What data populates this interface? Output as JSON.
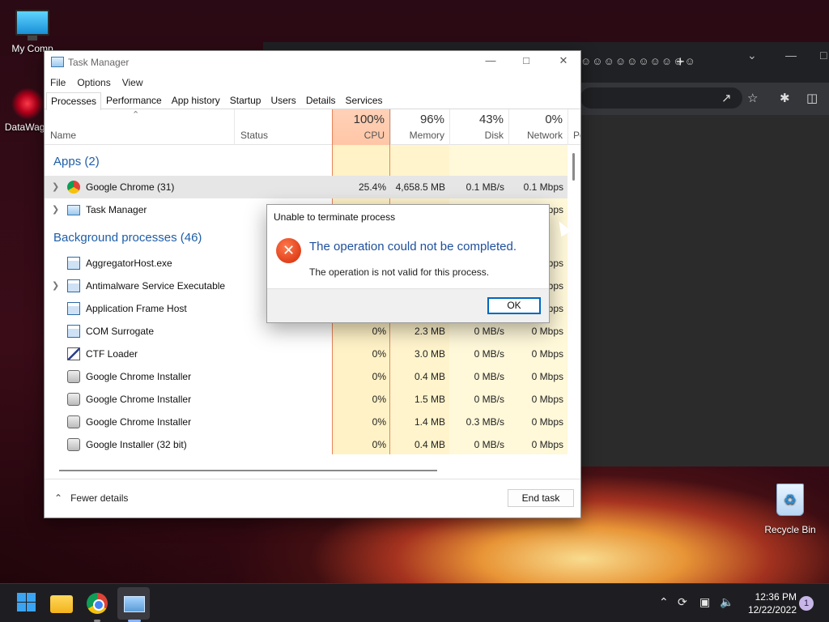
{
  "desktop": {
    "icons": [
      {
        "label": "My Comp"
      },
      {
        "label": "DataWage"
      }
    ],
    "recycle_bin_label": "Recycle Bin"
  },
  "browser_bg": {
    "tab_text": "☺☺☺☺☺☺☺☺☺☺",
    "new_tab": "+"
  },
  "task_manager": {
    "title": "Task Manager",
    "menu": [
      "File",
      "Options",
      "View"
    ],
    "tabs": [
      "Processes",
      "Performance",
      "App history",
      "Startup",
      "Users",
      "Details",
      "Services"
    ],
    "active_tab": "Processes",
    "columns": {
      "name": "Name",
      "status": "Status",
      "cpu": {
        "pct": "100%",
        "label": "CPU"
      },
      "memory": {
        "pct": "96%",
        "label": "Memory"
      },
      "disk": {
        "pct": "43%",
        "label": "Disk"
      },
      "network": {
        "pct": "0%",
        "label": "Network"
      },
      "power_partial": "Po"
    },
    "groups": {
      "apps": "Apps (2)",
      "background": "Background processes (46)"
    },
    "rows": [
      {
        "name": "Google Chrome (31)",
        "cpu": "25.4%",
        "memory": "4,658.5 MB",
        "disk": "0.1 MB/s",
        "network": "0.1 Mbps"
      },
      {
        "name": "Task Manager",
        "cpu": "",
        "memory": "",
        "disk": "",
        "network": "Mbps"
      },
      {
        "name": "AggregatorHost.exe",
        "cpu": "",
        "memory": "",
        "disk": "",
        "network": "Mbps"
      },
      {
        "name": "Antimalware Service Executable",
        "cpu": "",
        "memory": "",
        "disk": "",
        "network": "Mbps"
      },
      {
        "name": "Application Frame Host",
        "cpu": "",
        "memory": "",
        "disk": "",
        "network": "Mbps"
      },
      {
        "name": "COM Surrogate",
        "cpu": "0%",
        "memory": "2.3 MB",
        "disk": "0 MB/s",
        "network": "0 Mbps"
      },
      {
        "name": "CTF Loader",
        "cpu": "0%",
        "memory": "3.0 MB",
        "disk": "0 MB/s",
        "network": "0 Mbps"
      },
      {
        "name": "Google Chrome Installer",
        "cpu": "0%",
        "memory": "0.4 MB",
        "disk": "0 MB/s",
        "network": "0 Mbps"
      },
      {
        "name": "Google Chrome Installer",
        "cpu": "0%",
        "memory": "1.5 MB",
        "disk": "0 MB/s",
        "network": "0 Mbps"
      },
      {
        "name": "Google Chrome Installer",
        "cpu": "0%",
        "memory": "1.4 MB",
        "disk": "0.3 MB/s",
        "network": "0 Mbps"
      },
      {
        "name": "Google Installer (32 bit)",
        "cpu": "0%",
        "memory": "0.4 MB",
        "disk": "0 MB/s",
        "network": "0 Mbps"
      }
    ],
    "footer": {
      "fewer_details": "Fewer details",
      "end_task": "End task"
    }
  },
  "dialog": {
    "title": "Unable to terminate process",
    "heading": "The operation could not be completed.",
    "message": "The operation is not valid for this process.",
    "ok": "OK"
  },
  "taskbar": {
    "time": "12:36 PM",
    "date": "12/22/2022",
    "notifications": "1"
  }
}
